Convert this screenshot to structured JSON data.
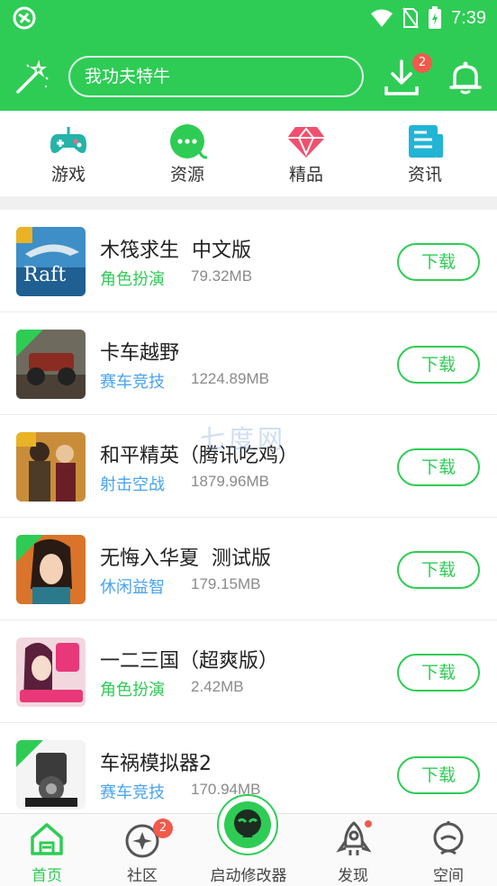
{
  "status": {
    "time": "7:39"
  },
  "search": {
    "placeholder": "我功夫特牛"
  },
  "downloads_badge": "2",
  "categories": [
    {
      "label": "游戏",
      "icon": "gamepad-icon"
    },
    {
      "label": "资源",
      "icon": "chat-bubble-icon"
    },
    {
      "label": "精品",
      "icon": "diamond-icon"
    },
    {
      "label": "资讯",
      "icon": "news-icon"
    }
  ],
  "apps": [
    {
      "name": "木筏求生  中文版",
      "genre": "角色扮演",
      "genre_color": "#2ecc55",
      "size": "79.32MB",
      "button": "下载"
    },
    {
      "name": "卡车越野",
      "genre": "赛车竞技",
      "genre_color": "#4aa3f0",
      "size": "1224.89MB",
      "button": "下载"
    },
    {
      "name": "和平精英（腾讯吃鸡）",
      "genre": "射击空战",
      "genre_color": "#4aa3f0",
      "size": "1879.96MB",
      "button": "下载"
    },
    {
      "name": "无悔入华夏  测试版",
      "genre": "休闲益智",
      "genre_color": "#4aa3f0",
      "size": "179.15MB",
      "button": "下载"
    },
    {
      "name": "一二三国（超爽版）",
      "genre": "角色扮演",
      "genre_color": "#2ecc55",
      "size": "2.42MB",
      "button": "下载"
    },
    {
      "name": "车祸模拟器2",
      "genre": "赛车竞技",
      "genre_color": "#4aa3f0",
      "size": "170.94MB",
      "button": "下载"
    }
  ],
  "watermark": "七度网",
  "tabs": [
    {
      "label": "首页",
      "icon": "home-icon",
      "active": true
    },
    {
      "label": "社区",
      "icon": "community-icon",
      "badge": "2"
    },
    {
      "label": "启动修改器",
      "icon": "launcher-icon"
    },
    {
      "label": "发现",
      "icon": "rocket-icon"
    },
    {
      "label": "空间",
      "icon": "profile-icon"
    }
  ],
  "colors": {
    "brand": "#2ecc55",
    "badge": "#f15a4a",
    "link_blue": "#4aa3f0"
  }
}
